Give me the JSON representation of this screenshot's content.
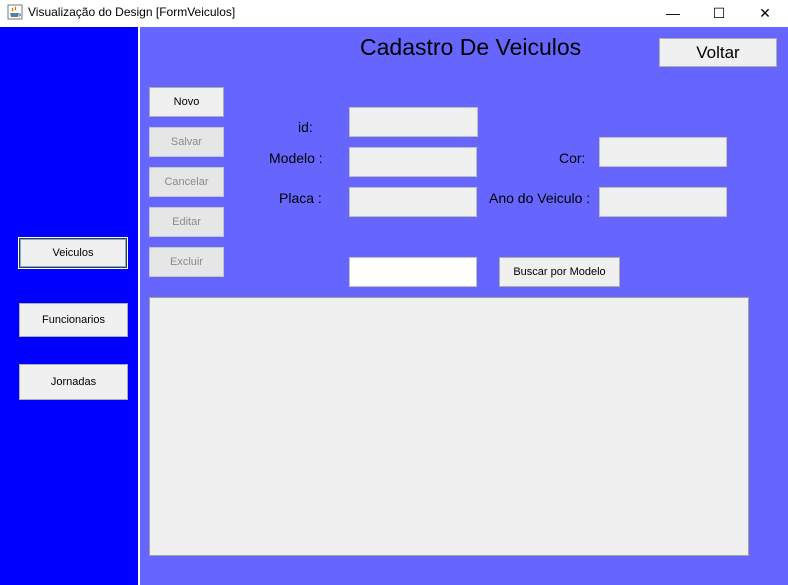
{
  "window": {
    "title": "Visualização do Design [FormVeiculos]",
    "icon": "java-cup-icon",
    "controls": {
      "minimize": "—",
      "maximize": "☐",
      "close": "✕"
    }
  },
  "colors": {
    "sidebar": "#0000ff",
    "main": "#6666ff",
    "field": "#f0f0f0"
  },
  "sidebar": {
    "items": [
      {
        "label": "Veiculos",
        "selected": true
      },
      {
        "label": "Funcionarios",
        "selected": false
      },
      {
        "label": "Jornadas",
        "selected": false
      }
    ]
  },
  "header": {
    "title": "Cadastro De Veiculos",
    "back_label": "Voltar"
  },
  "actions": {
    "novo": "Novo",
    "salvar": "Salvar",
    "cancelar": "Cancelar",
    "editar": "Editar",
    "excluir": "Excluir"
  },
  "form": {
    "id_label": "id:",
    "id_value": "",
    "modelo_label": "Modelo :",
    "modelo_value": "",
    "placa_label": "Placa :",
    "placa_value": "",
    "cor_label": "Cor:",
    "cor_value": "",
    "ano_label": "Ano do Veiculo :",
    "ano_value": ""
  },
  "search": {
    "value": "",
    "button_label": "Buscar por Modelo"
  }
}
